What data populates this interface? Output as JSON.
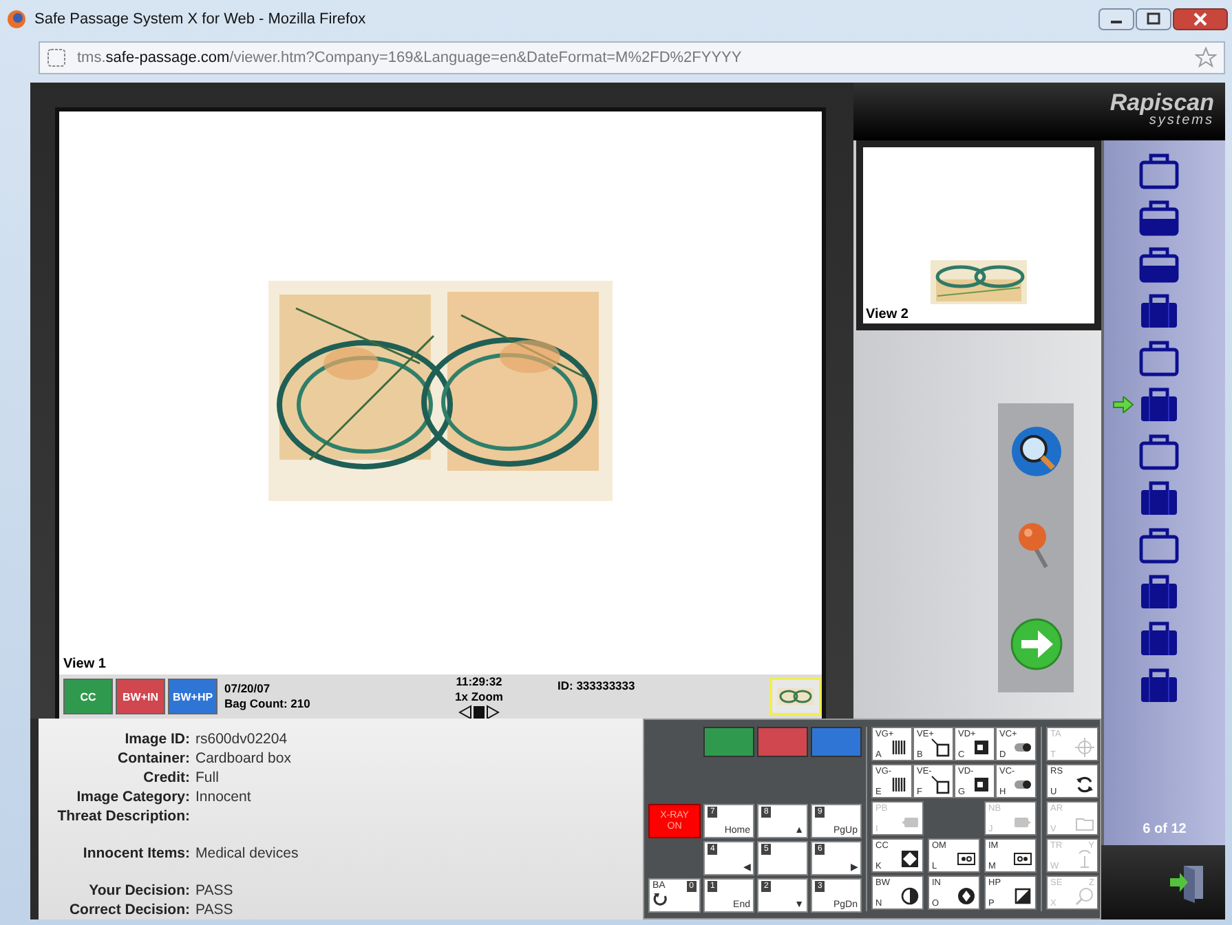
{
  "window": {
    "title": "Safe Passage System X for Web - Mozilla Firefox"
  },
  "address_bar": {
    "url": "tms.**safe-passage.com**/viewer.htm?Company=169&Language=en&DateFormat=M%2FD%2FYYYY"
  },
  "viewer": {
    "label": "View 1",
    "legend_buttons": [
      {
        "label": "CC",
        "color": "#2f9a4d"
      },
      {
        "label": "BW+IN",
        "color": "#d0474f"
      },
      {
        "label": "BW+HP",
        "color": "#2f75d6"
      }
    ],
    "date": "07/20/07",
    "bag_count": "Bag Count: 210",
    "time": "11:29:32",
    "zoom": "1x Zoom",
    "id": "ID: 333333333"
  },
  "brand": {
    "name": "Rapiscan",
    "tagline": "systems"
  },
  "thumbnail": {
    "label": "View 2"
  },
  "bags": [
    {
      "kind": "outline",
      "selected": false
    },
    {
      "kind": "half",
      "selected": false
    },
    {
      "kind": "half",
      "selected": false
    },
    {
      "kind": "filled",
      "selected": false
    },
    {
      "kind": "outline",
      "selected": false
    },
    {
      "kind": "filled",
      "selected": true
    },
    {
      "kind": "outline",
      "selected": false
    },
    {
      "kind": "filled",
      "selected": false
    },
    {
      "kind": "outline",
      "selected": false
    },
    {
      "kind": "filled",
      "selected": false
    },
    {
      "kind": "filled",
      "selected": false
    },
    {
      "kind": "filled",
      "selected": false
    }
  ],
  "bag_counter": "6 of 12",
  "details": [
    [
      {
        "label": "Image ID:",
        "value": "rs600dv02204"
      },
      {
        "label": "Container:",
        "value": "Cardboard box"
      },
      {
        "label": "Credit:",
        "value": "Full"
      },
      {
        "label": "Image Category:",
        "value": "Innocent"
      },
      {
        "label": "Threat Description:"
      }
    ],
    [
      {
        "label": "Innocent Items:",
        "value": "Medical devices"
      }
    ],
    [
      {
        "label": "Your Decision:",
        "value": "PASS"
      },
      {
        "label": "Correct Decision:",
        "value": "PASS"
      }
    ]
  ],
  "keypad": {
    "swatches": [
      {
        "color": "#2f9a4d"
      },
      {
        "color": "#d0474f"
      },
      {
        "color": "#2f75d6"
      }
    ],
    "xray": {
      "label": "X-RAY",
      "sub": "ON"
    },
    "back_key": {
      "label": "BA",
      "digit": "0"
    },
    "nav_rows": [
      [
        {
          "digit": "7",
          "label": "Home"
        },
        {
          "digit": "8",
          "label": "▲"
        },
        {
          "digit": "9",
          "label": "PgUp"
        }
      ],
      [
        {
          "digit": "4",
          "label": "◀"
        },
        {
          "digit": "5"
        },
        {
          "digit": "6",
          "label": "▶"
        }
      ],
      [
        {
          "digit": "1",
          "label": "End"
        },
        {
          "digit": "2",
          "label": "▼"
        },
        {
          "digit": "3",
          "label": "PgDn"
        }
      ]
    ],
    "function_rows": [
      [
        {
          "label": "VG+",
          "letter": "A",
          "disabled": false
        },
        {
          "label": "VE+",
          "letter": "B",
          "disabled": false
        },
        {
          "label": "VD+",
          "letter": "C",
          "disabled": false
        },
        {
          "label": "VC+",
          "letter": "D",
          "disabled": false
        }
      ],
      [
        {
          "label": "VG-",
          "letter": "E",
          "disabled": false
        },
        {
          "label": "VE-",
          "letter": "F",
          "disabled": false
        },
        {
          "label": "VD-",
          "letter": "G",
          "disabled": false
        },
        {
          "label": "VC-",
          "letter": "H",
          "disabled": false
        }
      ],
      [
        {
          "label": "PB",
          "letter": "I",
          "disabled": true
        },
        {
          "label": "NB",
          "letter": "J",
          "disabled": true
        }
      ],
      [
        {
          "label": "CC",
          "letter": "K",
          "disabled": false
        },
        {
          "label": "OM",
          "letter": "L",
          "disabled": false
        },
        {
          "label": "IM",
          "letter": "M",
          "disabled": false
        }
      ],
      [
        {
          "label": "BW",
          "letter": "N",
          "disabled": false
        },
        {
          "label": "IN",
          "letter": "O",
          "disabled": false
        },
        {
          "label": "HP",
          "letter": "P",
          "disabled": false
        }
      ]
    ],
    "side_keys": [
      {
        "label": "TA",
        "letter": "T",
        "disabled": true
      },
      {
        "label": "RS",
        "letter": "U",
        "disabled": false
      },
      {
        "label": "AR",
        "letter": "V",
        "disabled": true
      },
      {
        "label": "TR",
        "alt_letter": "Y",
        "letter": "W",
        "disabled": true
      },
      {
        "label": "SE",
        "alt_letter": "Z",
        "letter": "X",
        "disabled": true
      }
    ]
  }
}
